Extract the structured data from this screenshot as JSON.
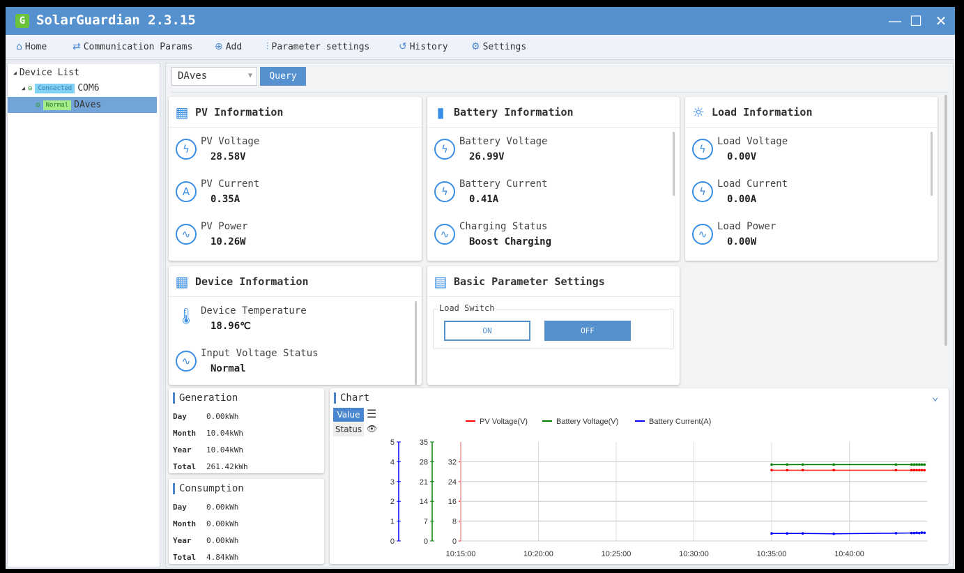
{
  "app": {
    "title": "SolarGuardian 2.3.15",
    "logo": "G"
  },
  "menu": [
    {
      "label": "Home",
      "icon": "home-icon"
    },
    {
      "label": "Communication Params",
      "icon": "swap-icon"
    },
    {
      "label": "Add",
      "icon": "plus-circle-icon"
    },
    {
      "label": "Parameter settings",
      "icon": "sliders-icon"
    },
    {
      "label": "History",
      "icon": "history-icon"
    },
    {
      "label": "Settings",
      "icon": "gear-icon"
    }
  ],
  "tree": {
    "root": "Device List",
    "port": {
      "status": "Connected",
      "name": "COM6"
    },
    "device": {
      "status": "Normal",
      "name": "DAves"
    }
  },
  "toolbar": {
    "device_select": "DAves",
    "query": "Query"
  },
  "pv": {
    "title": "PV Information",
    "items": [
      {
        "label": "PV Voltage",
        "value": "28.58V"
      },
      {
        "label": "PV Current",
        "value": "0.35A"
      },
      {
        "label": "PV Power",
        "value": "10.26W"
      }
    ]
  },
  "battery": {
    "title": "Battery Information",
    "items": [
      {
        "label": "Battery Voltage",
        "value": "26.99V"
      },
      {
        "label": "Battery Current",
        "value": "0.41A"
      },
      {
        "label": "Charging Status",
        "value": "Boost Charging"
      }
    ]
  },
  "load": {
    "title": "Load Information",
    "items": [
      {
        "label": "Load Voltage",
        "value": "0.00V"
      },
      {
        "label": "Load Current",
        "value": "0.00A"
      },
      {
        "label": "Load Power",
        "value": "0.00W"
      }
    ]
  },
  "device": {
    "title": "Device Information",
    "items": [
      {
        "label": "Device Temperature",
        "value": "18.96℃"
      },
      {
        "label": "Input Voltage Status",
        "value": "Normal"
      }
    ]
  },
  "basic": {
    "title": "Basic Parameter Settings",
    "group": "Load Switch",
    "on": "ON",
    "off": "OFF",
    "state": "OFF"
  },
  "generation": {
    "title": "Generation",
    "rows": [
      {
        "k": "Day",
        "v": "0.00kWh"
      },
      {
        "k": "Month",
        "v": "10.04kWh"
      },
      {
        "k": "Year",
        "v": "10.04kWh"
      },
      {
        "k": "Total",
        "v": "261.42kWh"
      }
    ]
  },
  "consumption": {
    "title": "Consumption",
    "rows": [
      {
        "k": "Day",
        "v": "0.00kWh"
      },
      {
        "k": "Month",
        "v": "0.00kWh"
      },
      {
        "k": "Year",
        "v": "0.00kWh"
      },
      {
        "k": "Total",
        "v": "4.84kWh"
      }
    ]
  },
  "chartpanel": {
    "title": "Chart",
    "tab_value": "Value",
    "tab_status": "Status"
  },
  "chart_data": {
    "type": "line",
    "x_ticks": [
      "10:15:00",
      "10:20:00",
      "10:25:00",
      "10:30:00",
      "10:35:00",
      "10:40:00"
    ],
    "xlim": [
      "10:15:00",
      "10:45:00"
    ],
    "grid": true,
    "legend": "top",
    "axes": [
      {
        "id": "pv",
        "color": "#ff0000",
        "ylim": [
          0,
          40
        ],
        "ticks": [
          0,
          8,
          16,
          24,
          32
        ]
      },
      {
        "id": "bv",
        "color": "#008000",
        "ylim": [
          0,
          35
        ],
        "ticks": [
          0,
          7,
          14,
          21,
          28,
          35
        ]
      },
      {
        "id": "bc",
        "color": "#0000ff",
        "ylim": [
          0,
          5
        ],
        "ticks": [
          0,
          1,
          2,
          3,
          4,
          5
        ]
      }
    ],
    "x": [
      "10:35:00",
      "10:36:00",
      "10:37:00",
      "10:39:00",
      "10:43:00",
      "10:44:00",
      "10:44:10",
      "10:44:20",
      "10:44:30",
      "10:44:40",
      "10:44:50"
    ],
    "series": [
      {
        "name": "PV Voltage(V)",
        "axis": "pv",
        "color": "#ff0000",
        "values": [
          28.6,
          28.6,
          28.6,
          28.6,
          28.6,
          28.6,
          28.6,
          28.6,
          28.6,
          28.6,
          28.58
        ]
      },
      {
        "name": "Battery Voltage(V)",
        "axis": "bv",
        "color": "#008000",
        "values": [
          27.0,
          27.0,
          27.0,
          27.0,
          27.0,
          27.0,
          27.0,
          27.0,
          27.0,
          27.0,
          26.99
        ]
      },
      {
        "name": "Battery Current(A)",
        "axis": "bc",
        "color": "#0000ff",
        "values": [
          0.38,
          0.38,
          0.38,
          0.36,
          0.39,
          0.4,
          0.4,
          0.41,
          0.4,
          0.42,
          0.41
        ]
      }
    ]
  }
}
